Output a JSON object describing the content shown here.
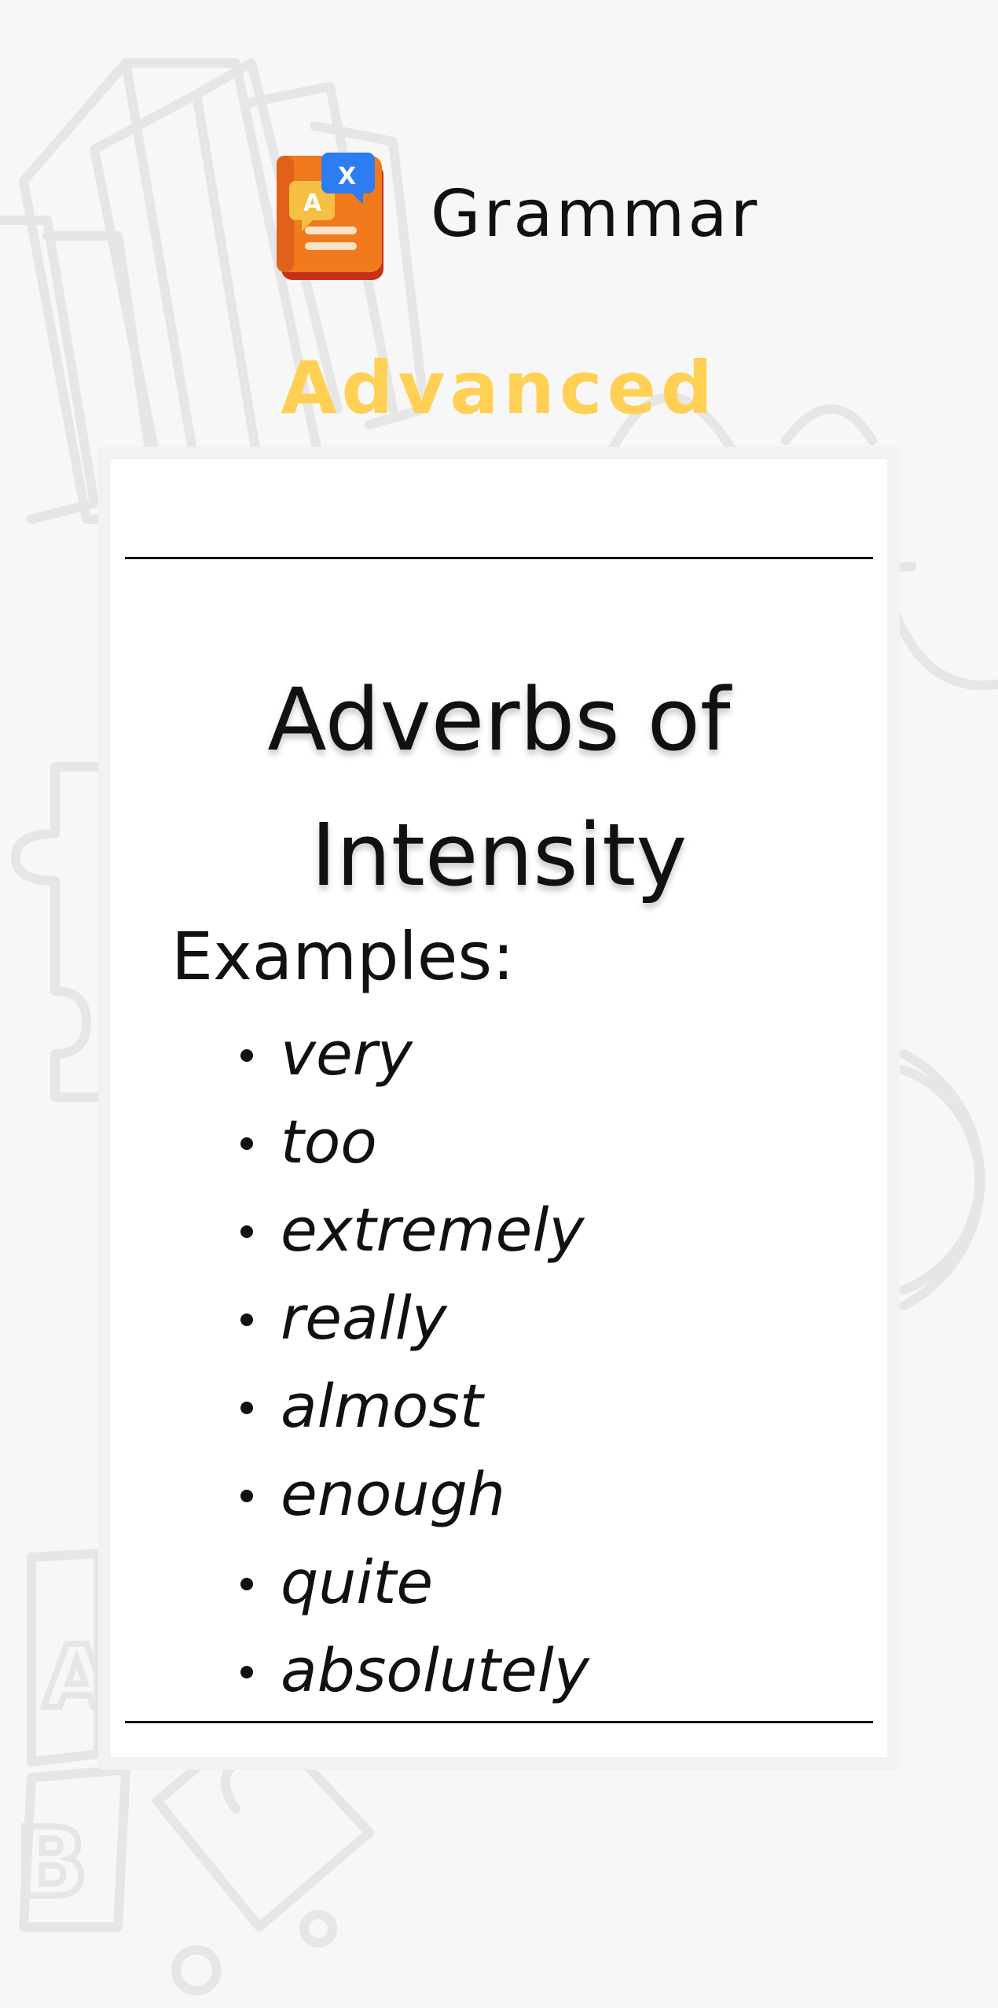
{
  "header": {
    "brand": "Grammar",
    "icon": "grammar-book-translate-icon"
  },
  "level": "Advanced",
  "card": {
    "title_line1": "Adverbs of",
    "title_line2": "Intensity",
    "examples_label": "Examples:",
    "examples": [
      "very",
      "too",
      "extremely",
      "really",
      "almost",
      "enough",
      "quite",
      "absolutely"
    ]
  },
  "colors": {
    "accent": "#ffd054",
    "icon_orange": "#f07a1c",
    "icon_blue": "#2d7cf0",
    "text": "#111111",
    "background": "#f7f7f7"
  }
}
